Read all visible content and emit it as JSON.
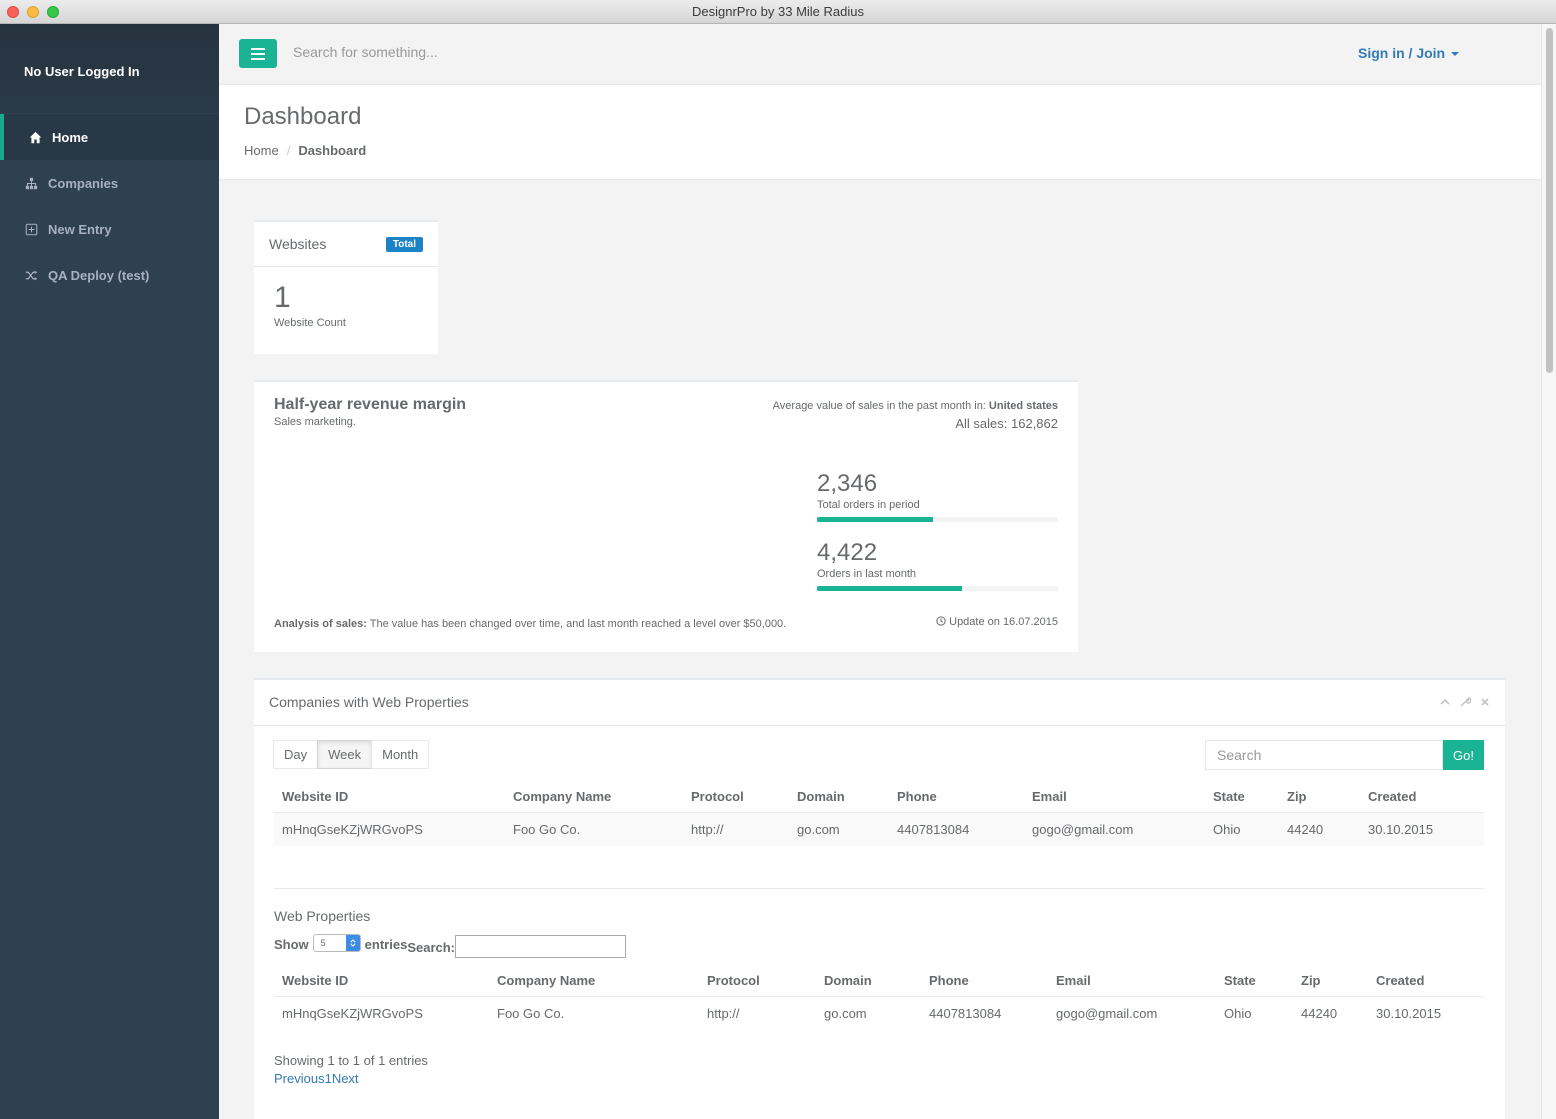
{
  "window": {
    "title": "DesignrPro by 33 Mile Radius"
  },
  "sidebar": {
    "user_label": "No User Logged In",
    "items": [
      {
        "label": "Home",
        "icon": "home-icon",
        "active": true
      },
      {
        "label": "Companies",
        "icon": "sitemap-icon",
        "active": false
      },
      {
        "label": "New Entry",
        "icon": "plus-square-icon",
        "active": false
      },
      {
        "label": "QA Deploy (test)",
        "icon": "shuffle-icon",
        "active": false
      }
    ]
  },
  "topbar": {
    "search_placeholder": "Search for something...",
    "signin_label": "Sign in / Join"
  },
  "page": {
    "title": "Dashboard",
    "breadcrumb": {
      "home": "Home",
      "sep": "/",
      "current": "Dashboard"
    }
  },
  "websites_widget": {
    "title": "Websites",
    "badge": "Total",
    "count": "1",
    "count_label": "Website Count"
  },
  "revenue_widget": {
    "title": "Half-year revenue margin",
    "subtitle": "Sales marketing.",
    "avg_label": "Average value of sales in the past month in: ",
    "avg_region": "United states",
    "all_sales": "All sales: 162,862",
    "stats": [
      {
        "value": "2,346",
        "label": "Total orders in period",
        "progress": 48
      },
      {
        "value": "4,422",
        "label": "Orders in last month",
        "progress": 60
      }
    ],
    "analysis_label": "Analysis of sales:",
    "analysis_text": " The value has been changed over time, and last month reached a level over $50,000.",
    "update_text": "Update on 16.07.2015"
  },
  "companies_widget": {
    "title": "Companies with Web Properties",
    "range_buttons": [
      "Day",
      "Week",
      "Month"
    ],
    "active_range": "Week",
    "search_placeholder": "Search",
    "go_label": "Go!",
    "table": {
      "headers": [
        "Website ID",
        "Company Name",
        "Protocol",
        "Domain",
        "Phone",
        "Email",
        "State",
        "Zip",
        "Created"
      ],
      "rows": [
        [
          "mHnqGseKZjWRGvoPS",
          "Foo Go Co.",
          "http://",
          "go.com",
          "4407813084",
          "gogo@gmail.com",
          "Ohio",
          "44240",
          "30.10.2015"
        ]
      ]
    }
  },
  "web_properties": {
    "title": "Web Properties",
    "show_label": "Show",
    "length_value": "5",
    "entries_label": "entries",
    "search_label": "Search:",
    "table": {
      "headers": [
        "Website ID",
        "Company Name",
        "Protocol",
        "Domain",
        "Phone",
        "Email",
        "State",
        "Zip",
        "Created"
      ],
      "rows": [
        [
          "mHnqGseKZjWRGvoPS",
          "Foo Go Co.",
          "http://",
          "go.com",
          "4407813084",
          "gogo@gmail.com",
          "Ohio",
          "44240",
          "30.10.2015"
        ]
      ]
    },
    "showing_text": "Showing 1 to 1 of 1 entries",
    "paging": {
      "prev": "Previous",
      "page": "1",
      "next": "Next"
    }
  },
  "colors": {
    "sidebar": "#2f4050",
    "accent": "#1ab394",
    "link": "#337ab7",
    "badge": "#1c84c6"
  }
}
